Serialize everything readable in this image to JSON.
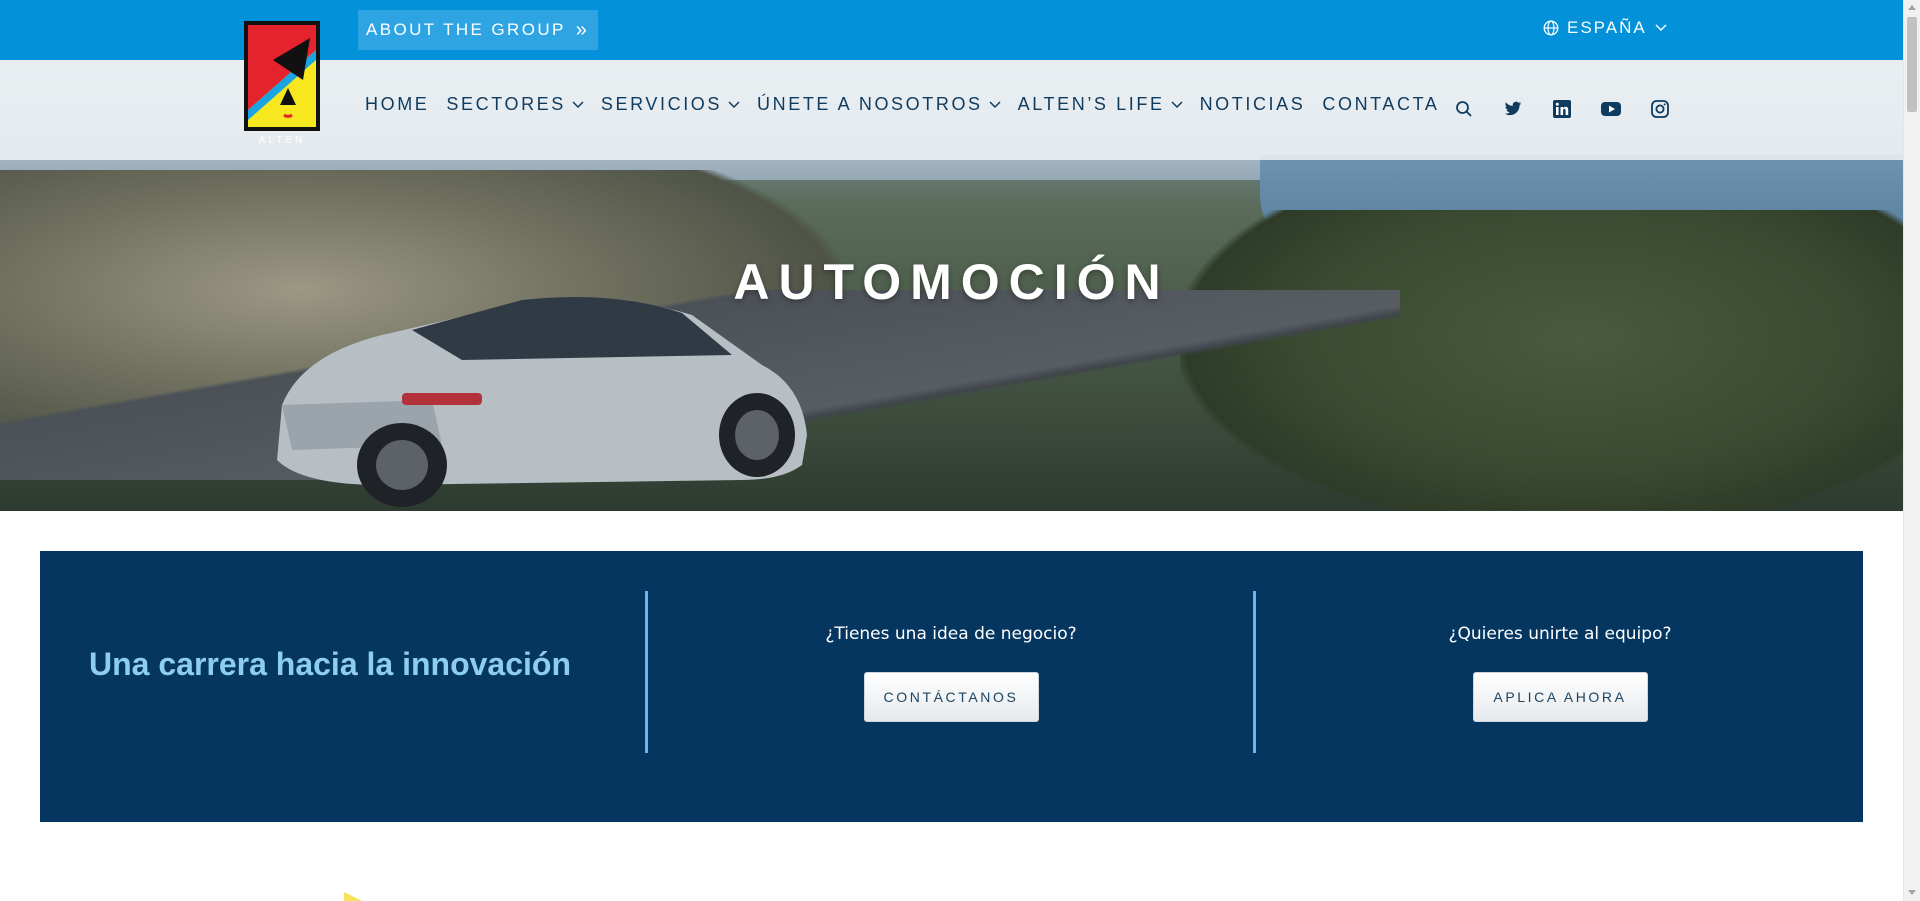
{
  "topbar": {
    "about_label": "ABOUT THE GROUP",
    "about_icon": "double-chevron-right-icon",
    "language_label": "ESPAÑA",
    "language_icon": "globe-icon",
    "bg_color": "#0391d9"
  },
  "logo": {
    "text": "ALTEN"
  },
  "nav": {
    "items": [
      {
        "label": "HOME",
        "has_dropdown": false
      },
      {
        "label": "SECTORES",
        "has_dropdown": true
      },
      {
        "label": "SERVICIOS",
        "has_dropdown": true
      },
      {
        "label": "ÚNETE A NOSOTROS",
        "has_dropdown": true
      },
      {
        "label": "ALTEN’S LIFE",
        "has_dropdown": true
      },
      {
        "label": "NOTICIAS",
        "has_dropdown": false
      },
      {
        "label": "CONTACTA",
        "has_dropdown": false
      }
    ],
    "icons": [
      "search-icon",
      "twitter-icon",
      "linkedin-icon",
      "youtube-icon",
      "instagram-icon"
    ]
  },
  "hero": {
    "title": "AUTOMOCIÓN"
  },
  "band": {
    "tagline": "Una carrera hacia la innovación",
    "col1": {
      "question": "¿Tienes una idea de negocio?",
      "button": "CONTÁCTANOS"
    },
    "col2": {
      "question": "¿Quieres unirte al equipo?",
      "button": "APLICA AHORA"
    },
    "bg_color": "#05365f",
    "accent_color": "#8dcdf0"
  }
}
